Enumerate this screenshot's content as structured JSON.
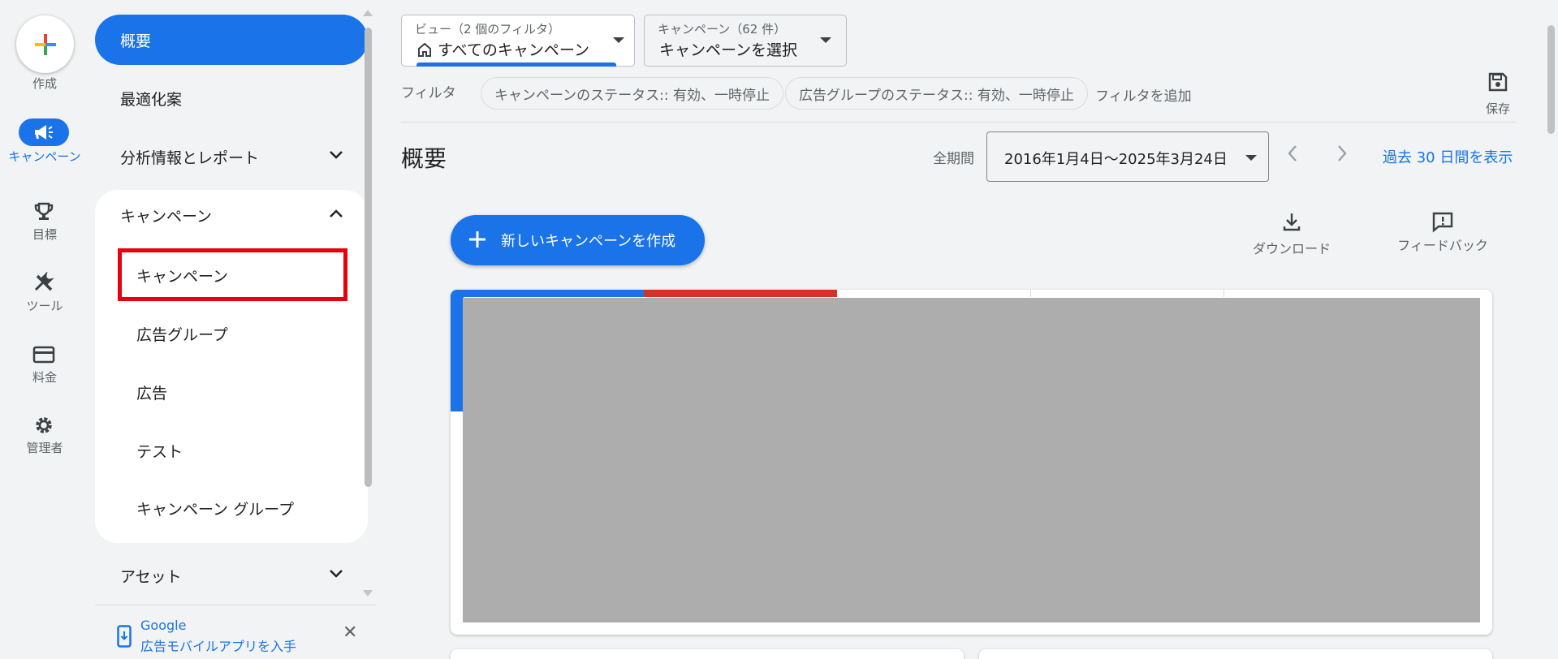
{
  "rail": {
    "create_label": "作成",
    "items": [
      {
        "label": "キャンペーン",
        "icon": "megaphone-icon",
        "active": true
      },
      {
        "label": "目標",
        "icon": "trophy-icon"
      },
      {
        "label": "ツール",
        "icon": "tools-icon"
      },
      {
        "label": "料金",
        "icon": "credit-card-icon"
      },
      {
        "label": "管理者",
        "icon": "gear-icon"
      }
    ]
  },
  "sidebar": {
    "overview": "概要",
    "recommendations": "最適化案",
    "insights": "分析情報とレポート",
    "campaigns_group": "キャンペーン",
    "sub_items": [
      "キャンペーン",
      "広告グループ",
      "広告",
      "テスト",
      "キャンペーン グループ"
    ],
    "assets": "アセット",
    "promo_line1": "Google",
    "promo_line2": "広告モバイルアプリを入手"
  },
  "header": {
    "view_label": "ビュー（2 個のフィルタ）",
    "view_value": "すべてのキャンペーン",
    "campaign_label": "キャンペーン（62 件）",
    "campaign_value": "キャンペーンを選択",
    "filter_label": "フィルタ",
    "chips": [
      "キャンペーンのステータス:: 有効、一時停止",
      "広告グループのステータス:: 有効、一時停止"
    ],
    "add_filter": "フィルタを追加",
    "save": "保存"
  },
  "main": {
    "title": "概要",
    "period_label": "全期間",
    "date_range": "2016年1月4日～2025年3月24日",
    "last30": "過去 30 日間を表示",
    "new_campaign": "新しいキャンペーンを作成",
    "download": "ダウンロード",
    "feedback": "フィードバック"
  },
  "colors": {
    "primary": "#1a73e8",
    "red": "#d93025",
    "highlight": "#e8000b"
  }
}
